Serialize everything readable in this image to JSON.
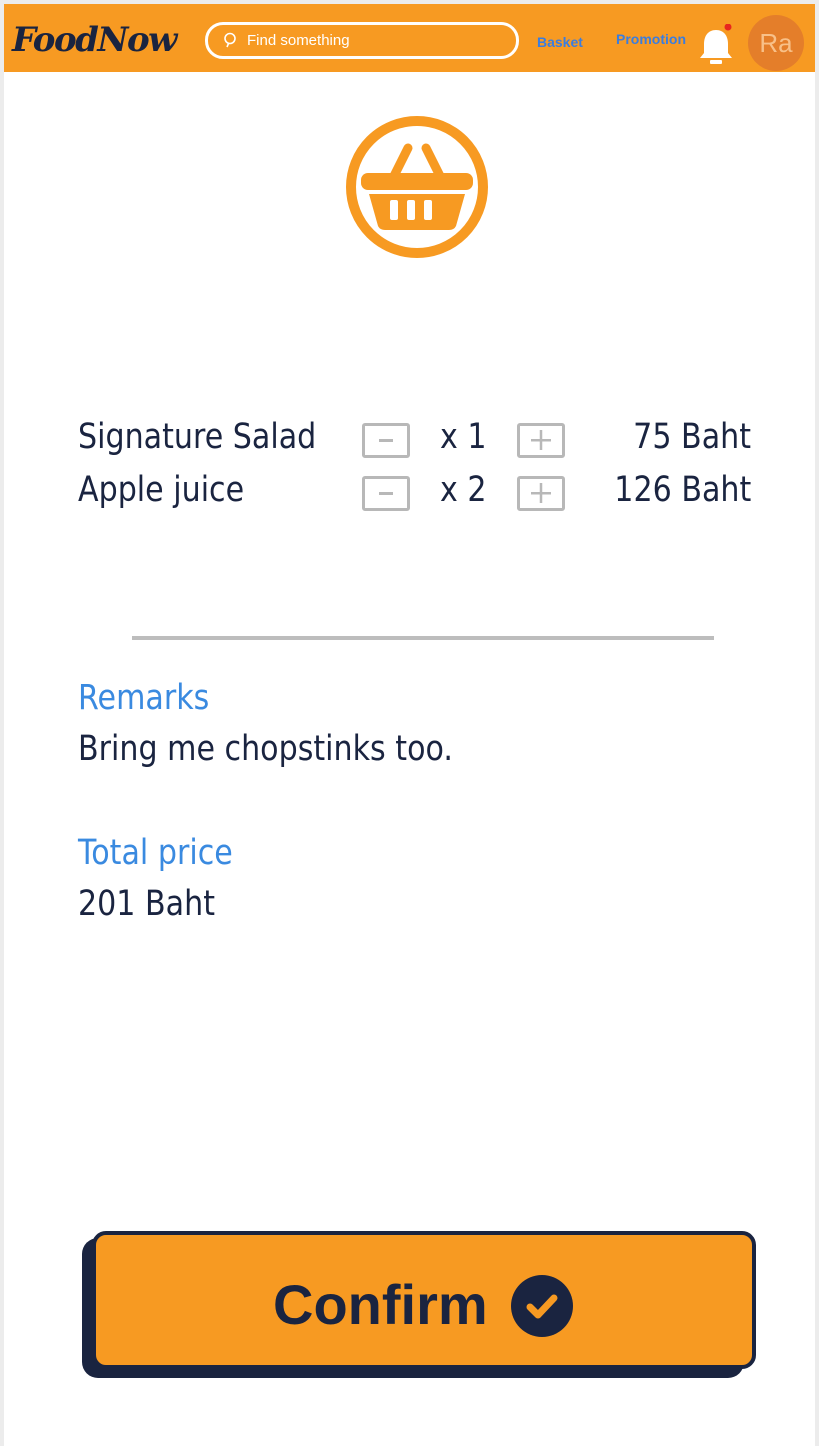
{
  "header": {
    "logo": "FoodNow",
    "search": {
      "placeholder": "Find something",
      "icon": "search-icon"
    },
    "nav": {
      "basket": "Basket",
      "promotion": "Promotion"
    },
    "notification": {
      "icon": "bell-icon",
      "has_unread": true
    },
    "avatar_initials": "Ra"
  },
  "page_icon": "shopping-basket-icon",
  "order": {
    "items": [
      {
        "name": "Signature Salad",
        "quantity": "x 1",
        "price": "75 Baht"
      },
      {
        "name": "Apple juice",
        "quantity": "x 2",
        "price": "126 Baht"
      }
    ],
    "remarks_label": "Remarks",
    "remarks": "Bring me chopstinks too.",
    "total_label": "Total price",
    "total": "201 Baht"
  },
  "confirm_label": "Confirm",
  "colors": {
    "accent": "#f79a22",
    "navy": "#1a2440",
    "link": "#3a7de0",
    "label_blue": "#3a8ae0",
    "avatar": "#e47e2a",
    "notification_dot": "#e8261e"
  }
}
